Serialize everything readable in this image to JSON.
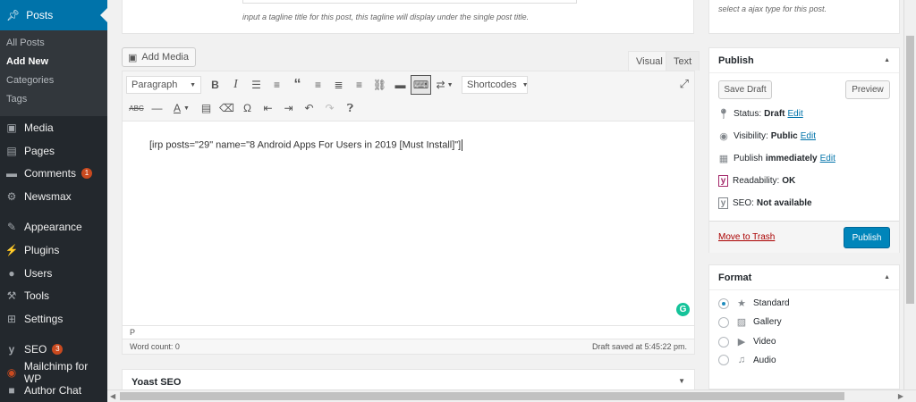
{
  "sidebar": {
    "active": "Posts",
    "submenu": [
      "All Posts",
      "Add New",
      "Categories",
      "Tags"
    ],
    "items": [
      {
        "label": "Media"
      },
      {
        "label": "Pages"
      },
      {
        "label": "Comments",
        "badge": "1"
      },
      {
        "label": "Newsmax"
      },
      {
        "label": "Appearance"
      },
      {
        "label": "Plugins"
      },
      {
        "label": "Users"
      },
      {
        "label": "Tools"
      },
      {
        "label": "Settings"
      },
      {
        "label": "SEO",
        "badge": "3"
      },
      {
        "label": "Mailchimp for WP"
      },
      {
        "label": "Author Chat"
      }
    ]
  },
  "tagline": {
    "description": "input a tagline title for this post, this tagline will display under the single post title."
  },
  "ajax_box": {
    "description": "select a ajax type for this post."
  },
  "editor": {
    "add_media": "Add Media",
    "tabs": {
      "visual": "Visual",
      "text": "Text"
    },
    "format_select": "Paragraph",
    "shortcodes": "Shortcodes",
    "content": "[irp posts=\"29\" name=\"8 Android Apps For Users in 2019 [Must Install]\"]",
    "path": "P",
    "word_count": "Word count: 0",
    "draft_saved": "Draft saved at 5:45:22 pm."
  },
  "yoast": {
    "title": "Yoast SEO"
  },
  "publish": {
    "title": "Publish",
    "save_draft": "Save Draft",
    "preview": "Preview",
    "status_label": "Status:",
    "status_value": "Draft",
    "visibility_label": "Visibility:",
    "visibility_value": "Public",
    "schedule_label": "Publish",
    "schedule_value": "immediately",
    "readability_label": "Readability:",
    "readability_value": "OK",
    "seo_label": "SEO:",
    "seo_value": "Not available",
    "edit": "Edit",
    "move_to_trash": "Move to Trash",
    "publish_button": "Publish"
  },
  "format": {
    "title": "Format",
    "options": [
      "Standard",
      "Gallery",
      "Video",
      "Audio"
    ],
    "selected": "Standard"
  },
  "colors": {
    "sidebar": "#23282d",
    "accent": "#0073aa",
    "publish": "#0085ba",
    "badge": "#ca4a1f",
    "grammarly": "#15c39a"
  }
}
